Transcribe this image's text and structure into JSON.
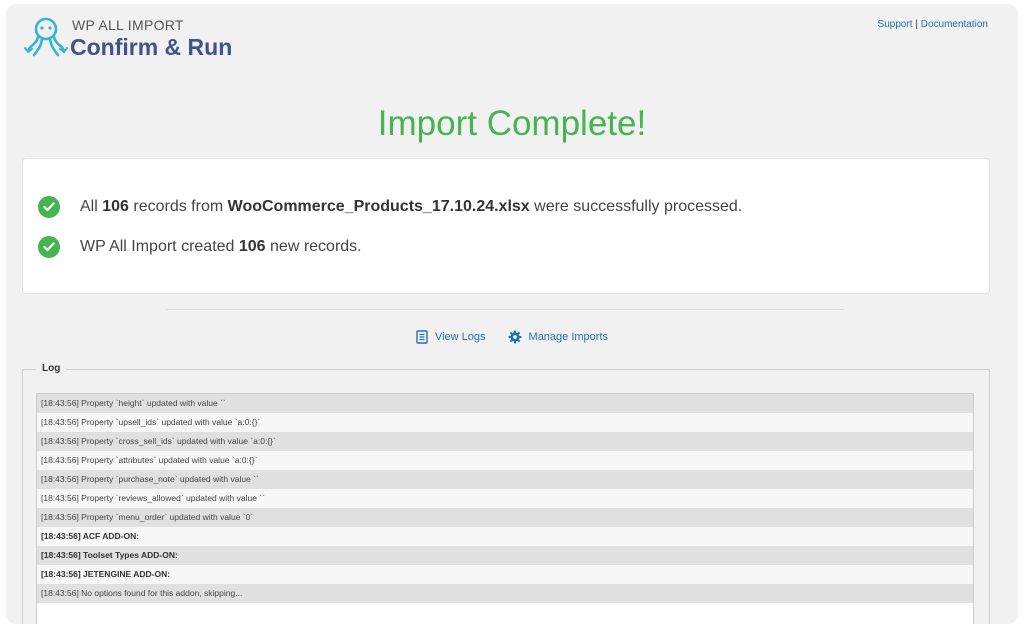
{
  "header": {
    "brand_small": "WP ALL IMPORT",
    "page_title": "Confirm & Run",
    "support_link": "Support",
    "link_separator": "|",
    "documentation_link": "Documentation"
  },
  "status": {
    "title": "Import Complete!"
  },
  "summary": {
    "line1": {
      "prefix": "All",
      "count": "106",
      "middle": "records from",
      "filename": "WooCommerce_Products_17.10.24.xlsx",
      "suffix": "were successfully processed."
    },
    "line2": {
      "prefix": "WP All Import created",
      "count": "106",
      "suffix": "new records."
    }
  },
  "actions": {
    "view_logs": "View Logs",
    "manage_imports": "Manage Imports"
  },
  "log": {
    "legend": "Log",
    "lines": [
      "[18:43:56] Property `height` updated with value ``",
      "[18:43:56] Property `upsell_ids` updated with value `a:0:{}`",
      "[18:43:56] Property `cross_sell_ids` updated with value `a:0:{}`",
      "[18:43:56] Property `attributes` updated with value `a:0:{}`",
      "[18:43:56] Property `purchase_note` updated with value ``",
      "[18:43:56] Property `reviews_allowed` updated with value ``",
      "[18:43:56] Property `menu_order` updated with value `0`",
      "[18:43:56] ACF ADD-ON:",
      "[18:43:56] Toolset Types ADD-ON:",
      "[18:43:56] JETENGINE ADD-ON:",
      "[18:43:56] No options found for this addon, skipping..."
    ]
  },
  "colors": {
    "success": "#46b450",
    "brand": "#40538a",
    "link": "#2271b1"
  }
}
